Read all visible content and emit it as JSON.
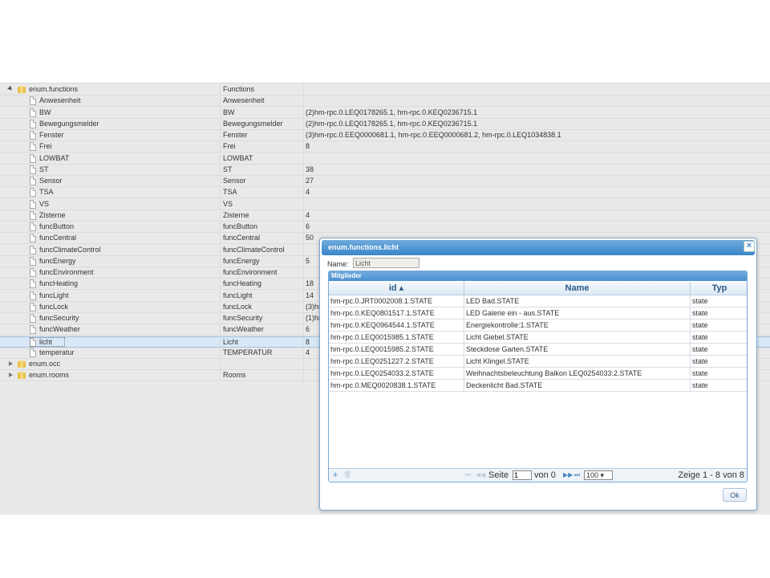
{
  "tree": {
    "rows": [
      {
        "label": "enum.functions",
        "name": "Functions",
        "members": ""
      },
      {
        "label": "Anwesenheit",
        "name": "Anwesenheit",
        "members": ""
      },
      {
        "label": "BW",
        "name": "BW",
        "members": "(2)hm-rpc.0.LEQ0178265.1, hm-rpc.0.KEQ0236715.1"
      },
      {
        "label": "Bewegungsmelder",
        "name": "Bewegungsmelder",
        "members": "(2)hm-rpc.0.LEQ0178265.1, hm-rpc.0.KEQ0236715.1"
      },
      {
        "label": "Fenster",
        "name": "Fenster",
        "members": "(3)hm-rpc.0.EEQ0000681.1, hm-rpc.0.EEQ0000681.2, hm-rpc.0.LEQ1034838.1"
      },
      {
        "label": "Frei",
        "name": "Frei",
        "members": "8"
      },
      {
        "label": "LOWBAT",
        "name": "LOWBAT",
        "members": ""
      },
      {
        "label": "ST",
        "name": "ST",
        "members": "38"
      },
      {
        "label": "Sensor",
        "name": "Sensor",
        "members": "27"
      },
      {
        "label": "TSA",
        "name": "TSA",
        "members": "4"
      },
      {
        "label": "VS",
        "name": "VS",
        "members": ""
      },
      {
        "label": "Zisterne",
        "name": "Zisterne",
        "members": "4"
      },
      {
        "label": "funcButton",
        "name": "funcButton",
        "members": "6"
      },
      {
        "label": "funcCentral",
        "name": "funcCentral",
        "members": "50"
      },
      {
        "label": "funcClimateControl",
        "name": "funcClimateControl",
        "members": ""
      },
      {
        "label": "funcEnergy",
        "name": "funcEnergy",
        "members": "5"
      },
      {
        "label": "funcEnvironment",
        "name": "funcEnvironment",
        "members": ""
      },
      {
        "label": "funcHeating",
        "name": "funcHeating",
        "members": "18"
      },
      {
        "label": "funcLight",
        "name": "funcLight",
        "members": "14"
      },
      {
        "label": "funcLock",
        "name": "funcLock",
        "members": "(3)hr"
      },
      {
        "label": "funcSecurity",
        "name": "funcSecurity",
        "members": "(1)hr"
      },
      {
        "label": "funcWeather",
        "name": "funcWeather",
        "members": "6"
      },
      {
        "label": "licht",
        "name": "Licht",
        "members": "8"
      },
      {
        "label": "temperatur",
        "name": "TEMPERATUR",
        "members": "4"
      },
      {
        "label": "enum.occ",
        "name": "",
        "members": ""
      },
      {
        "label": "enum.rooms",
        "name": "Rooms",
        "members": ""
      }
    ]
  },
  "dialog": {
    "title": "enum.functions.licht",
    "close": "×",
    "name_label": "Name:",
    "name_value": "Licht",
    "panel_caption": "Mitglieder",
    "columns": {
      "id": "id ▴",
      "name": "Name",
      "typ": "Typ"
    },
    "members": [
      {
        "id": "hm-rpc.0.JRT0002008.1.STATE",
        "name": "LED Bad.STATE",
        "typ": "state"
      },
      {
        "id": "hm-rpc.0.KEQ0801517.1.STATE",
        "name": "LED Galerie ein - aus.STATE",
        "typ": "state"
      },
      {
        "id": "hm-rpc.0.KEQ0964544.1.STATE",
        "name": "Energiekontrolle:1.STATE",
        "typ": "state"
      },
      {
        "id": "hm-rpc.0.LEQ0015985.1.STATE",
        "name": "Licht Giebel.STATE",
        "typ": "state"
      },
      {
        "id": "hm-rpc.0.LEQ0015985.2.STATE",
        "name": "Steckdose Garten.STATE",
        "typ": "state"
      },
      {
        "id": "hm-rpc.0.LEQ0251227.2.STATE",
        "name": "Licht Klingel.STATE",
        "typ": "state"
      },
      {
        "id": "hm-rpc.0.LEQ0254033.2.STATE",
        "name": "Weihnachtsbeleuchtung Balkon LEQ0254033:2.STATE",
        "typ": "state"
      },
      {
        "id": "hm-rpc.0.MEQ0020838.1.STATE",
        "name": "Deckenlicht Bad.STATE",
        "typ": "state"
      }
    ],
    "pager": {
      "add": "+",
      "delete": "🗑",
      "first": "⏮",
      "prev": "◀◀",
      "page_label": "Seite",
      "page_value": "1",
      "of_label": "von 0",
      "next": "▶▶",
      "last": "⏭",
      "rows_per_page": "100 ▾",
      "summary": "Zeige 1 - 8 von 8"
    },
    "ok_label": "Ok"
  }
}
